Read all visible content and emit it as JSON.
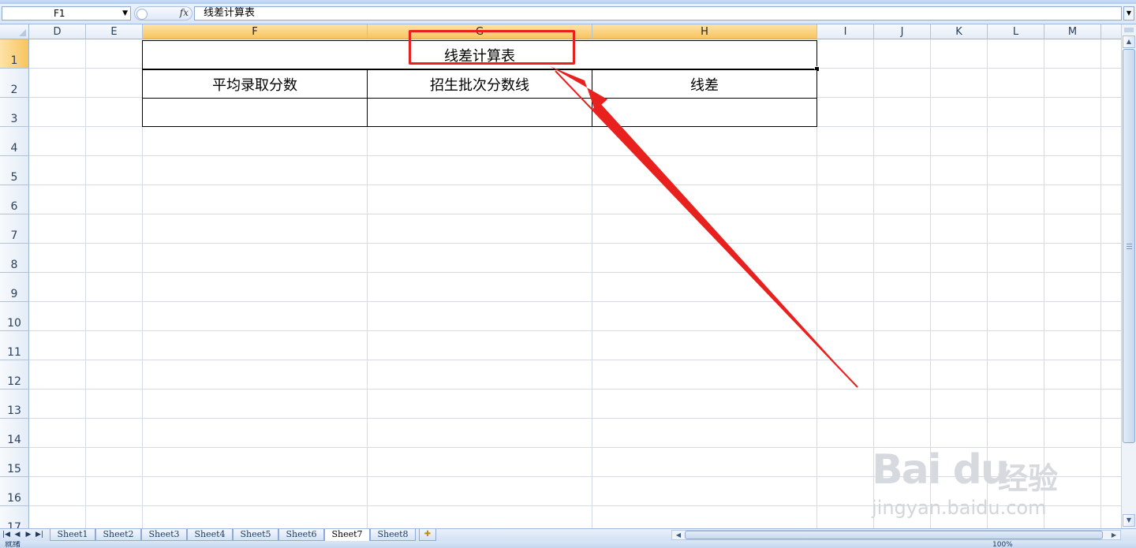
{
  "formula_bar": {
    "name_box": "F1",
    "fx_label": "fx",
    "formula": "线差计算表"
  },
  "columns": [
    "D",
    "E",
    "F",
    "G",
    "H",
    "I",
    "J",
    "K",
    "L",
    "M"
  ],
  "selected_columns": [
    "F",
    "G",
    "H"
  ],
  "rows": [
    "1",
    "2",
    "3",
    "4",
    "5",
    "6",
    "7",
    "8",
    "9",
    "10",
    "11",
    "12",
    "13",
    "14",
    "15",
    "16",
    "17"
  ],
  "selected_row": "1",
  "table": {
    "title": "线差计算表",
    "headers": [
      "平均录取分数",
      "招生批次分数线",
      "线差"
    ],
    "values": [
      "",
      "",
      ""
    ]
  },
  "sheets": {
    "tabs": [
      "Sheet1",
      "Sheet2",
      "Sheet3",
      "Sheet4",
      "Sheet5",
      "Sheet6",
      "Sheet7",
      "Sheet8"
    ],
    "active": "Sheet7"
  },
  "status": {
    "ready": "就绪",
    "zoom": "100%"
  },
  "watermark": {
    "brand": "Bai du",
    "cn": "经验",
    "sub": "jingyan.baidu.com"
  },
  "colors": {
    "annotation_red": "#e8211e",
    "selected_header": "#f7c45e"
  }
}
